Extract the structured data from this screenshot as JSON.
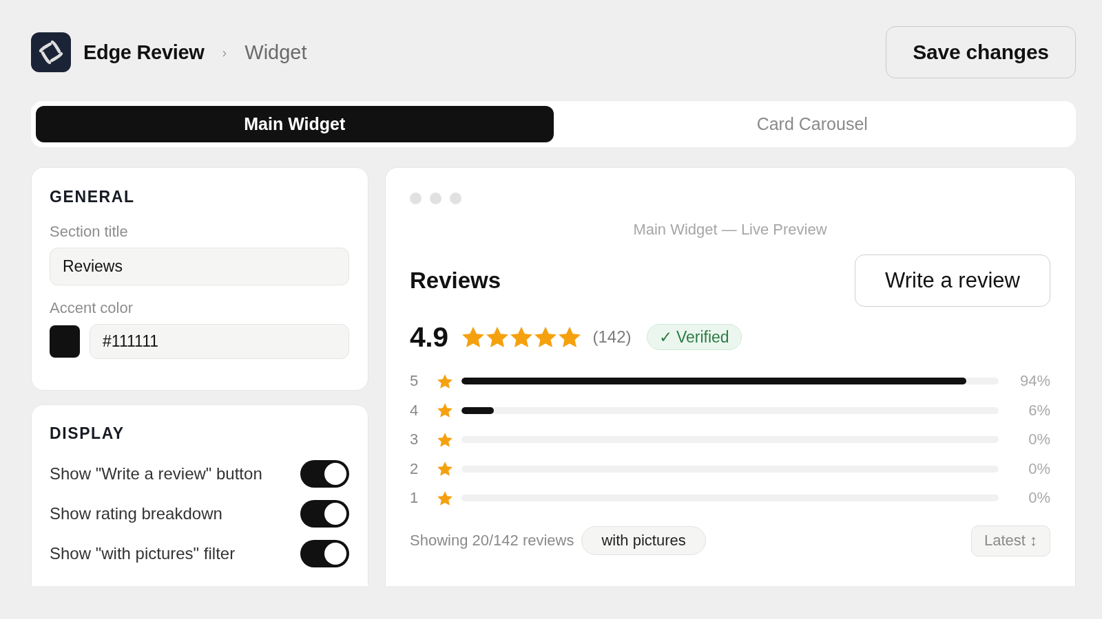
{
  "header": {
    "brand": "Edge Review",
    "separator": "›",
    "page": "Widget",
    "save_button": "Save changes"
  },
  "tabs": [
    {
      "label": "Main Widget",
      "selected": true
    },
    {
      "label": "Card Carousel",
      "selected": false
    }
  ],
  "general": {
    "heading": "GENERAL",
    "fields": [
      {
        "kind": "text",
        "label": "Section title",
        "value": "Reviews"
      },
      {
        "kind": "color",
        "label": "Accent color",
        "value": "#111111",
        "color": "#111111"
      }
    ]
  },
  "display": {
    "heading": "DISPLAY",
    "toggles": [
      {
        "label": "Show \"Write a review\" button",
        "on": true
      },
      {
        "label": "Show rating breakdown",
        "on": true
      },
      {
        "label": "Show \"with pictures\" filter",
        "on": true
      }
    ]
  },
  "preview": {
    "caption": "Main Widget — Live Preview",
    "title": "Reviews",
    "write_button": "Write a review",
    "rating": "4.9",
    "stars": 5,
    "count": "(142)",
    "badge": "✓ Verified",
    "breakdown": [
      {
        "label": "5",
        "level": 0.94,
        "reading": "94%"
      },
      {
        "label": "4",
        "level": 0.06,
        "reading": "6%"
      },
      {
        "label": "3",
        "reading": "0%"
      },
      {
        "label": "2",
        "reading": "0%"
      },
      {
        "label": "1",
        "reading": "0%"
      }
    ],
    "footer": {
      "summary": "Showing 20/142 reviews",
      "filter": "with pictures",
      "sort": "Latest ↕"
    }
  }
}
